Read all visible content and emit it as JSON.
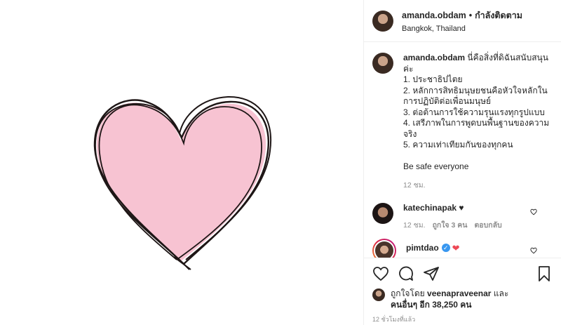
{
  "header": {
    "username": "amanda.obdam",
    "separator": "•",
    "follow_label": "กำลังติดตาม",
    "location": "Bangkok, Thailand"
  },
  "caption": {
    "username": "amanda.obdam",
    "lines": [
      "นี่คือสิ่งที่ดิฉันสนับสนุนค่ะ",
      "1. ประชาธิปไตย",
      "2. หลักการสิทธิมนุษยชนคือหัวใจหลักใน",
      "การปฏิบัติต่อเพื่อนมนุษย์",
      "3. ต่อต้านการใช้ความรุนแรงทุกรูปแบบ",
      "4. เสรีภาพในการพูดบนพื้นฐานของความ",
      "จริง",
      "5. ความเท่าเทียมกันของทุกคน",
      "",
      "Be safe everyone"
    ],
    "time": "12 ชม."
  },
  "comments": [
    {
      "username": "katechinapak",
      "text": "♥",
      "time": "12 ชม.",
      "likes": "ถูกใจ 3 คน",
      "reply": "ตอบกลับ"
    },
    {
      "username": "pimtdao",
      "verified_mark": "✓",
      "text": "❤"
    }
  ],
  "likes": {
    "prefix": "ถูกใจโดย",
    "user": "veenapraveenar",
    "and": "และ",
    "others": "คนอื่นๆ อีก 38,250 คน"
  },
  "posted_time": "12 ชั่วโมงที่แล้ว",
  "icons": {
    "like": "heart-outline-icon",
    "comment": "comment-icon",
    "share": "share-icon",
    "save": "bookmark-icon"
  },
  "colors": {
    "heart_fill": "#f7c3d2",
    "heart_stroke": "#1e1616",
    "verified": "#3897f0",
    "red_heart": "#ed4956"
  }
}
